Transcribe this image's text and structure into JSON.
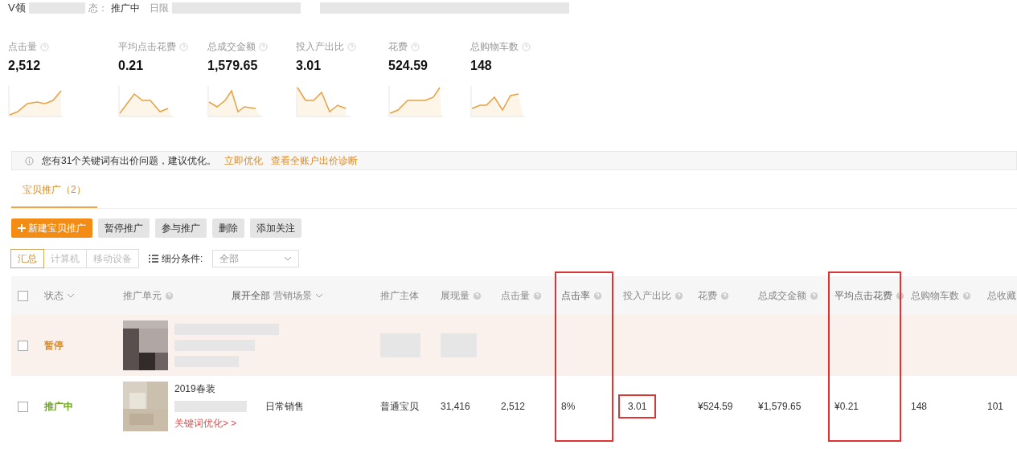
{
  "header": {
    "title": "V领",
    "status_label": "态：",
    "status": "推广中",
    "budget_label": "日限"
  },
  "metrics": [
    {
      "label": "点击量",
      "value": "2,512"
    },
    {
      "label": "平均点击花费",
      "value": "0.21"
    },
    {
      "label": "总成交金额",
      "value": "1,579.65"
    },
    {
      "label": "投入产出比",
      "value": "3.01"
    },
    {
      "label": "花费",
      "value": "524.59"
    },
    {
      "label": "总购物车数",
      "value": "148"
    }
  ],
  "notice": {
    "text": "您有31个关键词有出价问题，建议优化。",
    "links": [
      "立即优化",
      "查看全账户出价诊断"
    ]
  },
  "tabs": [
    {
      "label": "宝贝推广（2）",
      "selected": true
    }
  ],
  "actions": [
    {
      "label": "新建宝贝推广",
      "kind": "primary"
    },
    {
      "label": "暂停推广",
      "kind": "plain"
    },
    {
      "label": "参与推广",
      "kind": "plain"
    },
    {
      "label": "删除",
      "kind": "plain"
    },
    {
      "label": "添加关注",
      "kind": "plain"
    }
  ],
  "device_filter": [
    {
      "label": "汇总",
      "selected": true
    },
    {
      "label": "计算机",
      "selected": false
    },
    {
      "label": "移动设备",
      "selected": false
    }
  ],
  "segment": {
    "label": "细分条件:",
    "value": "全部"
  },
  "table": {
    "header_checked": false,
    "columns": [
      {
        "label": "状态",
        "dropdown": true,
        "help": false,
        "highlighted": false
      },
      {
        "label": "推广单元",
        "dropdown": false,
        "help": true,
        "highlighted": false
      },
      {
        "label": "营销场景",
        "prefix": "展开全部",
        "dropdown": true,
        "help": false,
        "highlighted": false
      },
      {
        "label": "推广主体",
        "dropdown": false,
        "help": false,
        "highlighted": false
      },
      {
        "label": "展现量",
        "dropdown": false,
        "help": true,
        "highlighted": false
      },
      {
        "label": "点击量",
        "dropdown": false,
        "help": true,
        "highlighted": false
      },
      {
        "label": "点击率",
        "dropdown": false,
        "help": true,
        "highlighted": true
      },
      {
        "label": "投入产出比",
        "dropdown": false,
        "help": true,
        "highlighted": false
      },
      {
        "label": "花费",
        "dropdown": false,
        "help": true,
        "highlighted": false
      },
      {
        "label": "总成交金额",
        "dropdown": false,
        "help": true,
        "highlighted": false
      },
      {
        "label": "平均点击花费",
        "dropdown": false,
        "help": true,
        "highlighted": true
      },
      {
        "label": "总购物车数",
        "dropdown": false,
        "help": true,
        "highlighted": false
      },
      {
        "label": "总收藏"
      }
    ],
    "rows": [
      {
        "checked": false,
        "status": "暂停",
        "active": false,
        "redacted": true
      },
      {
        "checked": false,
        "status": "推广中",
        "active": true,
        "redacted": false,
        "title": "2019春装",
        "note": "关键词优化> >",
        "cells": [
          {
            "text": "日常销售",
            "highlighted": false
          },
          {
            "text": "普通宝贝",
            "highlighted": false
          },
          {
            "text": "31,416",
            "highlighted": false
          },
          {
            "text": "2,512",
            "highlighted": false
          },
          {
            "text": "8%",
            "highlighted": false
          },
          {
            "text": "3.01",
            "highlighted": true
          },
          {
            "text": "¥524.59",
            "highlighted": false
          },
          {
            "text": "¥1,579.65",
            "highlighted": false
          },
          {
            "text": "¥0.21",
            "highlighted": false
          },
          {
            "text": "148",
            "highlighted": false
          },
          {
            "text": "101",
            "highlighted": false
          }
        ]
      }
    ]
  }
}
